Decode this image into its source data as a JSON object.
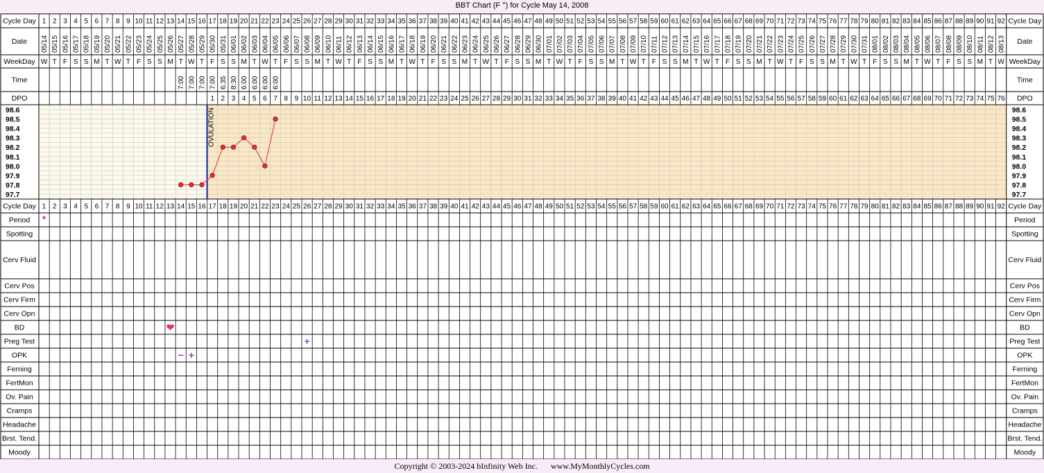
{
  "title": "BBT Chart (F °) for Cycle May 14, 2008",
  "copyright": "Copyright © 2003-2024 bInfinity Web Inc.",
  "website": "www.MyMonthlyCycles.com",
  "ovulation_label": "OVULATION",
  "row_labels": {
    "cycle_day": "Cycle Day",
    "date": "Date",
    "weekday": "WeekDay",
    "time": "Time",
    "dpo": "DPO",
    "period": "Period",
    "spotting": "Spotting",
    "cerv_fluid": "Cerv Fluid",
    "cerv_pos": "Cerv Pos",
    "cerv_firm": "Cerv Firm",
    "cerv_opn": "Cerv Opn",
    "bd": "BD",
    "preg_test": "Preg Test",
    "opk": "OPK",
    "ferning": "Ferning",
    "fertmon": "FertMon",
    "ov_pain": "Ov. Pain",
    "cramps": "Cramps",
    "headache": "Headache",
    "brst_tend": "Brst. Tend.",
    "moody": "Moody"
  },
  "dates": [
    "05/14",
    "05/15",
    "05/16",
    "05/17",
    "05/18",
    "05/19",
    "05/20",
    "05/21",
    "05/22",
    "05/23",
    "05/24",
    "05/25",
    "05/26",
    "05/27",
    "05/28",
    "05/29",
    "05/30",
    "05/31",
    "06/01",
    "06/02",
    "06/03",
    "06/04",
    "06/05",
    "06/06",
    "06/07",
    "06/08",
    "06/09",
    "06/10",
    "06/11",
    "06/12",
    "06/13",
    "06/14",
    "06/15",
    "06/16",
    "06/17",
    "06/18",
    "06/19",
    "06/20",
    "06/21",
    "06/22",
    "06/23",
    "06/24",
    "06/25",
    "06/26",
    "06/27",
    "06/28",
    "06/29",
    "06/30",
    "07/01",
    "07/02",
    "07/03",
    "07/04",
    "07/05",
    "07/06",
    "07/07",
    "07/08",
    "07/09",
    "07/10",
    "07/11",
    "07/12",
    "07/13",
    "07/14",
    "07/15",
    "07/16",
    "07/17",
    "07/18",
    "07/19",
    "07/20",
    "07/21",
    "07/22",
    "07/23",
    "07/24",
    "07/25",
    "07/26",
    "07/27",
    "07/28",
    "07/29",
    "07/30",
    "07/31",
    "08/01",
    "08/02",
    "08/03",
    "08/04",
    "08/05",
    "08/06",
    "08/07",
    "08/08",
    "08/09",
    "08/10",
    "08/11",
    "08/12",
    "08/13"
  ],
  "weekdays": [
    "W",
    "T",
    "F",
    "S",
    "S",
    "M",
    "T",
    "W",
    "T",
    "F",
    "S",
    "S",
    "M",
    "T",
    "W",
    "T",
    "F",
    "S",
    "S",
    "M",
    "T",
    "W",
    "T",
    "F",
    "S",
    "S",
    "M",
    "T",
    "W",
    "T",
    "F",
    "S",
    "S",
    "M",
    "T",
    "W",
    "T",
    "F",
    "S",
    "S",
    "M",
    "T",
    "W",
    "T",
    "F",
    "S",
    "S",
    "M",
    "T",
    "W",
    "T",
    "F",
    "S",
    "S",
    "M",
    "T",
    "W",
    "T",
    "F",
    "S",
    "S",
    "M",
    "T",
    "W",
    "T",
    "F",
    "S",
    "S",
    "M",
    "T",
    "W",
    "T",
    "F",
    "S",
    "S",
    "M",
    "T",
    "W",
    "T",
    "F",
    "S",
    "S",
    "M",
    "T",
    "W",
    "T",
    "F",
    "S",
    "S",
    "M",
    "T",
    "W"
  ],
  "times": {
    "14": "7:00",
    "15": "7:00",
    "16": "7:00",
    "17": "7:00",
    "18": "6:35",
    "19": "8:30",
    "20": "6:00",
    "21": "6:00",
    "22": "6:00",
    "23": "6:00"
  },
  "dpo_start_day": 17,
  "dpo_count": 76,
  "events": {
    "period": [
      {
        "day": 1,
        "symbol": "•",
        "color": "#e040c8"
      }
    ],
    "bd": [
      {
        "day": 13,
        "symbol": "❤",
        "color": "#e0307a"
      }
    ],
    "preg_test": [
      {
        "day": 26,
        "symbol": "+",
        "color": "#8a3fc8"
      }
    ],
    "opk": [
      {
        "day": 14,
        "symbol": "−",
        "color": "#8a3fc8"
      },
      {
        "day": 15,
        "symbol": "+",
        "color": "#8a3fc8"
      }
    ]
  },
  "colors": {
    "pre_ovulation_bg": "#fdf9ec",
    "post_ovulation_bg": "#fbe7c4",
    "grid": "#c8c8c8",
    "ovulation_line": "#1020a0",
    "temp_line": "#e03030",
    "temp_point": "#e03030"
  },
  "chart_data": {
    "type": "line",
    "title": "BBT Chart (F °) for Cycle May 14, 2008",
    "xlabel": "Cycle Day",
    "ylabel": "",
    "x": [
      14,
      15,
      16,
      17,
      18,
      19,
      20,
      21,
      22,
      23
    ],
    "values": [
      97.8,
      97.8,
      97.8,
      97.9,
      98.2,
      98.2,
      98.3,
      98.2,
      98.0,
      98.5
    ],
    "y_ticks": [
      98.6,
      98.5,
      98.4,
      98.3,
      98.2,
      98.1,
      98.0,
      97.9,
      97.8,
      97.7
    ],
    "ylim": [
      97.7,
      98.6
    ],
    "xlim": [
      1,
      92
    ],
    "ovulation_day": 16,
    "grid": true
  }
}
